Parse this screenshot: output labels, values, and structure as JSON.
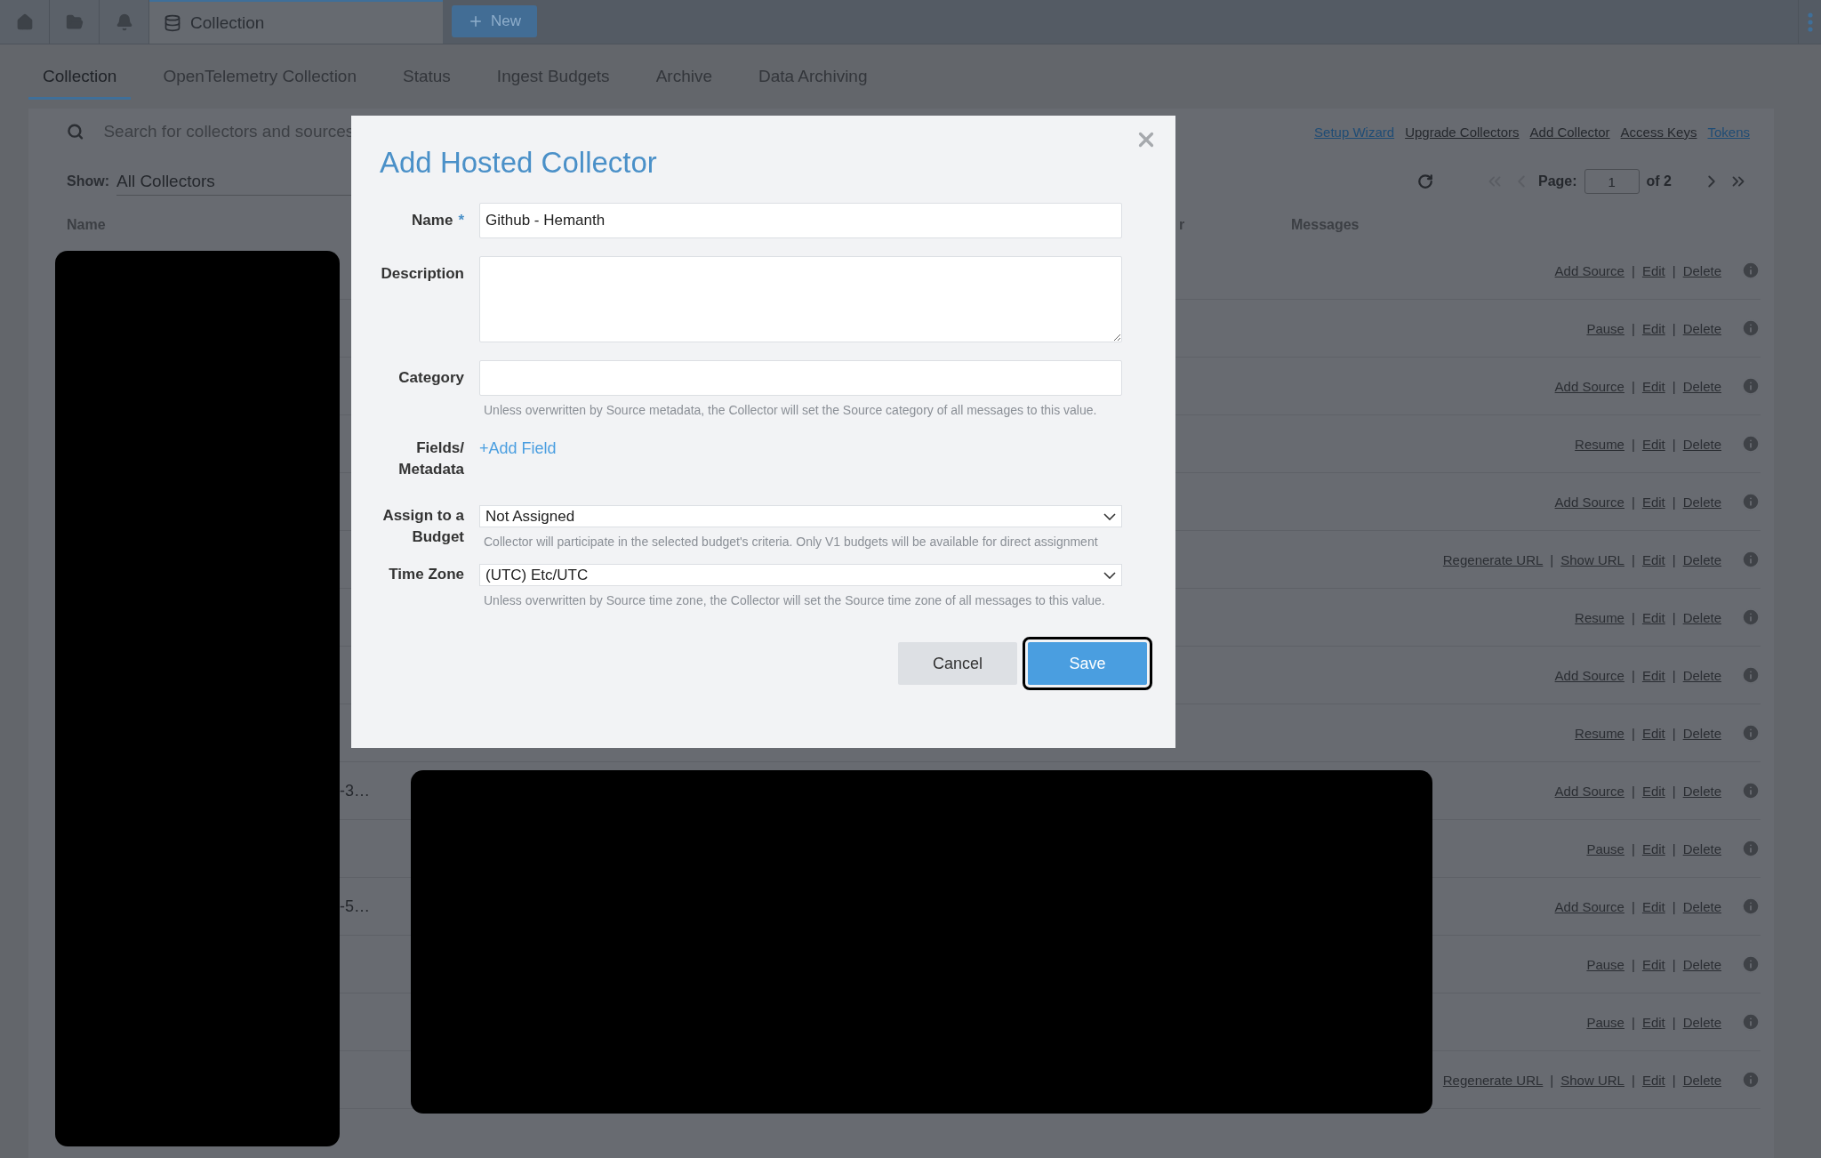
{
  "top_bar": {
    "icon_tabs": [
      {
        "kind": "home"
      },
      {
        "kind": "folder"
      },
      {
        "kind": "bell"
      }
    ],
    "tab": {
      "label": "Collection"
    },
    "new_button": {
      "label": "New"
    }
  },
  "nav_tabs": [
    {
      "label": "Collection",
      "selected": true
    },
    {
      "label": "OpenTelemetry Collection",
      "selected": false
    },
    {
      "label": "Status",
      "selected": false
    },
    {
      "label": "Ingest Budgets",
      "selected": false
    },
    {
      "label": "Archive",
      "selected": false
    },
    {
      "label": "Data Archiving",
      "selected": false
    }
  ],
  "search": {
    "placeholder": "Search for collectors and sources"
  },
  "links": [
    {
      "label": "Setup Wizard",
      "kind": "accent"
    },
    {
      "label": "Upgrade Collectors",
      "kind": "plain"
    },
    {
      "label": "Add Collector",
      "kind": "plain"
    },
    {
      "label": "Access Keys",
      "kind": "plain"
    },
    {
      "label": "Tokens",
      "kind": "accent"
    }
  ],
  "show": {
    "label": "Show:",
    "value": "All Collectors"
  },
  "pagination": {
    "label": "Page:",
    "value": "1",
    "total": "of 2",
    "controls": [
      {
        "kind": "first",
        "disabled": true
      },
      {
        "kind": "prev",
        "disabled": true
      },
      {
        "kind": "next",
        "disabled": false
      },
      {
        "kind": "last",
        "disabled": false
      }
    ]
  },
  "table": {
    "columns": [
      "Name",
      "r",
      "Messages"
    ],
    "separator": "|",
    "rows": [
      {
        "actions": [
          "Add Source",
          "Edit",
          "Delete"
        ]
      },
      {
        "actions": [
          "Pause",
          "Edit",
          "Delete"
        ]
      },
      {
        "actions": [
          "Add Source",
          "Edit",
          "Delete"
        ]
      },
      {
        "actions": [
          "Resume",
          "Edit",
          "Delete"
        ]
      },
      {
        "actions": [
          "Add Source",
          "Edit",
          "Delete"
        ]
      },
      {
        "actions": [
          "Regenerate URL",
          "Show URL",
          "Edit",
          "Delete"
        ]
      },
      {
        "actions": [
          "Resume",
          "Edit",
          "Delete"
        ]
      },
      {
        "actions": [
          "Add Source",
          "Edit",
          "Delete"
        ]
      },
      {
        "actions": [
          "Resume",
          "Edit",
          "Delete"
        ]
      },
      {
        "name": "-3…",
        "actions": [
          "Add Source",
          "Edit",
          "Delete"
        ]
      },
      {
        "actions": [
          "Pause",
          "Edit",
          "Delete"
        ]
      },
      {
        "name": "-5…",
        "actions": [
          "Add Source",
          "Edit",
          "Delete"
        ]
      },
      {
        "actions": [
          "Pause",
          "Edit",
          "Delete"
        ]
      },
      {
        "actions": [
          "Pause",
          "Edit",
          "Delete"
        ]
      },
      {
        "actions": [
          "Regenerate URL",
          "Show URL",
          "Edit",
          "Delete"
        ]
      }
    ]
  },
  "dialog": {
    "title": "Add Hosted Collector",
    "fields": [
      {
        "kind": "text",
        "label": "Name",
        "required_mark": "*",
        "value": "Github - Hemanth"
      },
      {
        "kind": "textarea",
        "label": "Description"
      },
      {
        "kind": "text",
        "label": "Category",
        "hint": "Unless overwritten by Source metadata, the Collector will set the Source category of all messages to this value."
      },
      {
        "kind": "link",
        "label": "Fields/ Metadata",
        "link": "+Add Field"
      },
      {
        "kind": "select",
        "label": "Assign to a Budget",
        "value": "Not Assigned",
        "hint": "Collector will participate in the selected budget's criteria. Only V1 budgets will be available for direct assignment"
      },
      {
        "kind": "select",
        "label": "Time Zone",
        "value": "(UTC) Etc/UTC",
        "hint": "Unless overwritten by Source time zone, the Collector will set the Source time zone of all messages to this value."
      }
    ],
    "buttons": [
      {
        "label": "Cancel",
        "kind": "secondary",
        "focused": false
      },
      {
        "label": "Save",
        "kind": "primary",
        "focused": true
      }
    ]
  }
}
